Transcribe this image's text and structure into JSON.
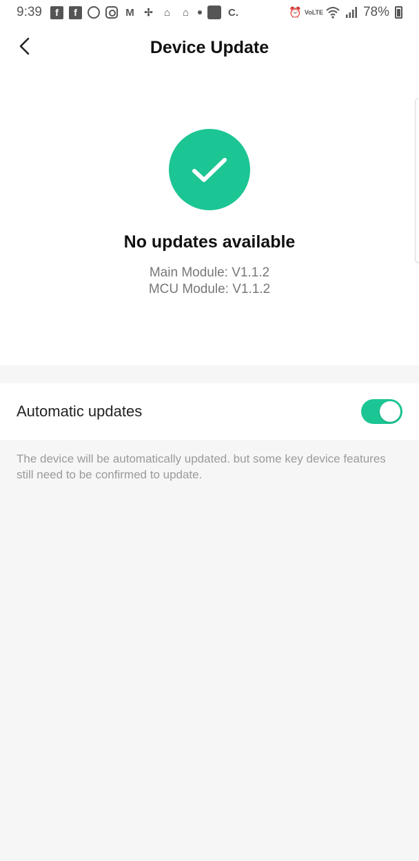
{
  "status_bar": {
    "time": "9:39",
    "battery": "78%",
    "icons": [
      "facebook-icon",
      "facebook-icon",
      "chrome-icon",
      "instagram-icon",
      "gmail-icon",
      "pinwheel-icon",
      "home-icon",
      "home-icon",
      "dot-icon",
      "ifttt-icon",
      "c-icon",
      "alarm-icon",
      "volte-icon",
      "wifi-icon",
      "signal-icon",
      "battery-icon"
    ]
  },
  "header": {
    "title": "Device Update"
  },
  "update_status": {
    "title": "No updates available",
    "main_module": "Main Module: V1.1.2",
    "mcu_module": "MCU Module: V1.1.2"
  },
  "auto_updates": {
    "label": "Automatic updates",
    "enabled": true,
    "description": "The device will be automatically updated. but some key device features still need to be confirmed to update."
  },
  "colors": {
    "accent": "#1cc594",
    "background": "#f6f6f6"
  }
}
